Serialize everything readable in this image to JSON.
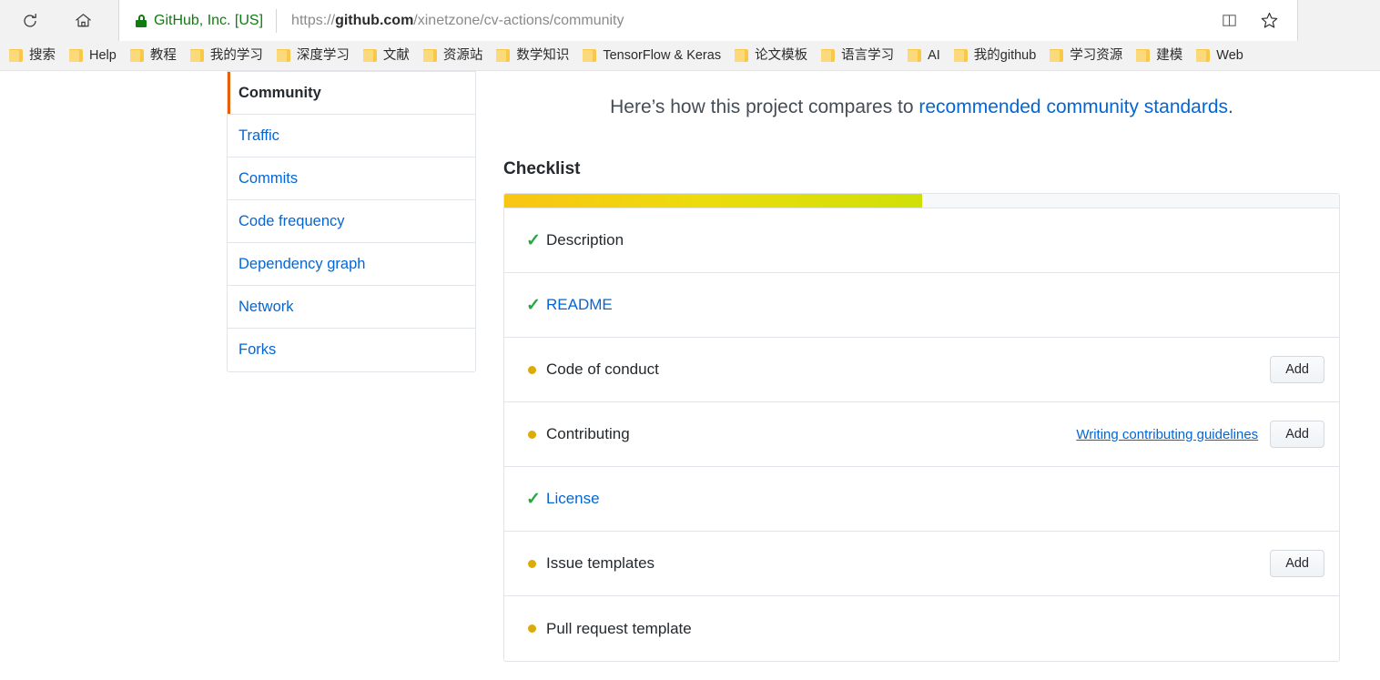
{
  "browser": {
    "reload_icon": "reload-icon",
    "home_icon": "home-icon",
    "security_label": "GitHub, Inc. [US]",
    "url_scheme": "https://",
    "url_host": "github.com",
    "url_path": "/xinetzone/cv-actions/community",
    "reading_view_icon": "book-icon",
    "favorite_icon": "star-icon",
    "bookmarks": [
      {
        "label": "搜索"
      },
      {
        "label": "Help"
      },
      {
        "label": "教程"
      },
      {
        "label": "我的学习"
      },
      {
        "label": "深度学习"
      },
      {
        "label": "文献"
      },
      {
        "label": "资源站"
      },
      {
        "label": "数学知识"
      },
      {
        "label": "TensorFlow & Keras"
      },
      {
        "label": "论文模板"
      },
      {
        "label": "语言学习"
      },
      {
        "label": "AI"
      },
      {
        "label": "我的github"
      },
      {
        "label": "学习资源"
      },
      {
        "label": "建模"
      },
      {
        "label": "Web"
      }
    ]
  },
  "sidebar": {
    "items": [
      {
        "label": "Community",
        "selected": true
      },
      {
        "label": "Traffic",
        "selected": false
      },
      {
        "label": "Commits",
        "selected": false
      },
      {
        "label": "Code frequency",
        "selected": false
      },
      {
        "label": "Dependency graph",
        "selected": false
      },
      {
        "label": "Network",
        "selected": false
      },
      {
        "label": "Forks",
        "selected": false
      }
    ]
  },
  "main": {
    "intro_prefix": "Here’s how this project compares to ",
    "intro_link": "recommended community standards",
    "intro_suffix": ".",
    "checklist_title": "Checklist",
    "progress_percent": 50,
    "progress_colors": {
      "start": "#f9c513",
      "end": "#cfe008",
      "track": "#f6f8fa"
    },
    "accent_colors": {
      "complete": "#28a745",
      "incomplete": "#dbab09",
      "link": "#0366d6",
      "selected_marker": "#e36209"
    },
    "checklist": [
      {
        "label": "Description",
        "status": "complete",
        "is_link": false,
        "helper": "",
        "action": ""
      },
      {
        "label": "README",
        "status": "complete",
        "is_link": true,
        "helper": "",
        "action": ""
      },
      {
        "label": "Code of conduct",
        "status": "incomplete",
        "is_link": false,
        "helper": "",
        "action": "Add"
      },
      {
        "label": "Contributing",
        "status": "incomplete",
        "is_link": false,
        "helper": "Writing contributing guidelines",
        "action": "Add"
      },
      {
        "label": "License",
        "status": "complete",
        "is_link": true,
        "helper": "",
        "action": ""
      },
      {
        "label": "Issue templates",
        "status": "incomplete",
        "is_link": false,
        "helper": "",
        "action": "Add"
      },
      {
        "label": "Pull request template",
        "status": "incomplete",
        "is_link": false,
        "helper": "",
        "action": ""
      }
    ]
  }
}
